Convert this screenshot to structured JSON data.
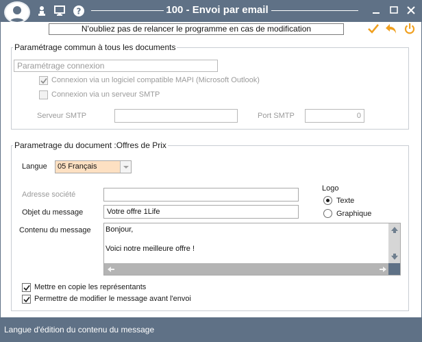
{
  "window": {
    "title": "100 - Envoi par email"
  },
  "reminder": "N'oubliez pas de relancer le programme en cas de modification",
  "common": {
    "group_title": "Paramétrage commun à tous les documents",
    "connection_placeholder": "Paramétrage connexion",
    "mapi_label": "Connexion via un logiciel compatible MAPI (Microsoft Outlook)",
    "mapi_checked": true,
    "smtp_label": "Connexion via un serveur SMTP",
    "smtp_checked": false,
    "smtp_server_label": "Serveur SMTP",
    "smtp_server_value": "",
    "smtp_port_label": "Port SMTP",
    "smtp_port_value": "0"
  },
  "document": {
    "group_title": "Parametrage du document :Offres de Prix",
    "language_label": "Langue",
    "language_value": "05  Français",
    "company_address_label": "Adresse société",
    "company_address_value": "",
    "subject_label": "Objet du message",
    "subject_value": "Votre offre 1Life",
    "content_label": "Contenu du message",
    "content_value": "Bonjour,\n\nVoici notre meilleure offre !",
    "logo_label": "Logo",
    "logo_options": [
      "Texte",
      "Graphique"
    ],
    "logo_selected": "Texte",
    "copy_reps_label": "Mettre en copie les représentants",
    "copy_reps_checked": true,
    "allow_edit_label": "Permettre de modifier le message avant l'envoi",
    "allow_edit_checked": true
  },
  "status_bar": "Langue d'édition du contenu du message",
  "colors": {
    "chrome": "#5f7186",
    "accent": "#f0a020",
    "language_field": "#fde0c2"
  }
}
